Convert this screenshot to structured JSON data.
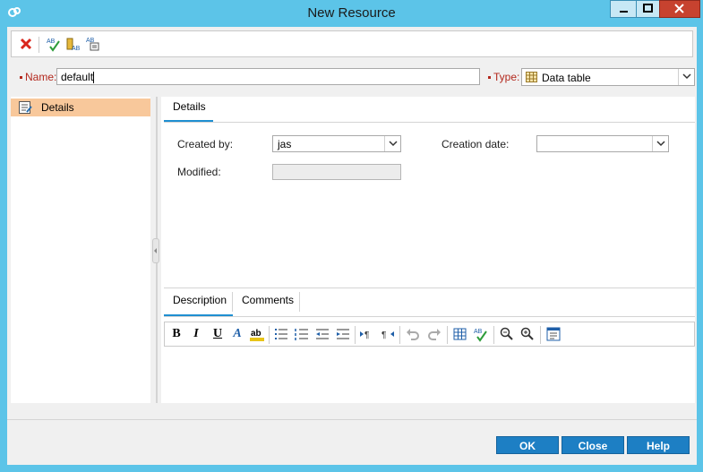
{
  "window": {
    "title": "New Resource"
  },
  "toolbar": {
    "buttons": [
      "delete-icon",
      "spell-check-icon",
      "thesaurus-icon",
      "spelling-options-icon"
    ]
  },
  "fields": {
    "name_label": "Name:",
    "name_value": "default",
    "type_label": "Type:",
    "type_value": "Data table"
  },
  "nav": {
    "items": [
      {
        "label": "Details"
      }
    ]
  },
  "details": {
    "tab_label": "Details",
    "created_by_label": "Created by:",
    "created_by_value": "jas",
    "creation_date_label": "Creation date:",
    "creation_date_value": "",
    "modified_label": "Modified:"
  },
  "lower_tabs": [
    "Description",
    "Comments"
  ],
  "footer": {
    "ok": "OK",
    "close": "Close",
    "help": "Help"
  },
  "colors": {
    "title_bar": "#5cc4e8",
    "accent": "#1d7fc4",
    "required": "#b3281d",
    "nav_selected": "#f8c89b"
  }
}
